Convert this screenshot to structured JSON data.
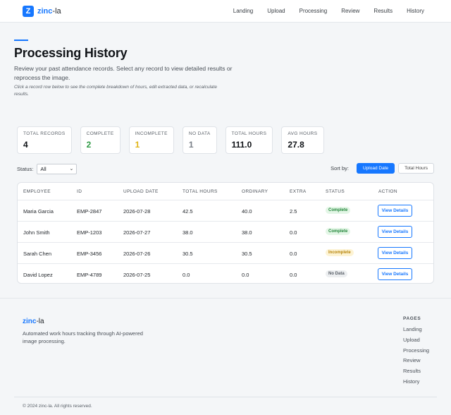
{
  "nav": {
    "logo_glyph": "Z",
    "brand_accent": "zinc",
    "brand_rest": "-la",
    "links": [
      "Landing",
      "Upload",
      "Processing",
      "Review",
      "Results",
      "History"
    ]
  },
  "header": {
    "title": "Processing History",
    "subtitle": "Review your past attendance records. Select any record to view detailed results or reprocess the image.",
    "hint": "Click a record row below to see the complete breakdown of hours, edit extracted data, or recalculate results."
  },
  "stats": [
    {
      "label": "Total Records",
      "value": "4",
      "color": "#111418"
    },
    {
      "label": "Complete",
      "value": "2",
      "color": "#2e9a45"
    },
    {
      "label": "Incomplete",
      "value": "1",
      "color": "#e0b416"
    },
    {
      "label": "No Data",
      "value": "1",
      "color": "#7a8088"
    },
    {
      "label": "Total Hours",
      "value": "111.0",
      "color": "#111418"
    },
    {
      "label": "Avg Hours",
      "value": "27.8",
      "color": "#111418"
    }
  ],
  "filter": {
    "label": "Status:",
    "selected": "All"
  },
  "sort": {
    "label": "Sort by:",
    "options": [
      "Upload Date",
      "Total Hours"
    ],
    "active": "Upload Date"
  },
  "table": {
    "columns": [
      "Employee",
      "ID",
      "Upload Date",
      "Total Hours",
      "Ordinary",
      "Extra",
      "Status",
      "Action"
    ],
    "rows": [
      {
        "employee": "Maria Garcia",
        "id": "EMP-2847",
        "date": "2026-07-28",
        "total": "42.5",
        "ordinary": "40.0",
        "extra": "2.5",
        "status": "Complete",
        "status_kind": "complete",
        "action": "View Details"
      },
      {
        "employee": "John Smith",
        "id": "EMP-1203",
        "date": "2026-07-27",
        "total": "38.0",
        "ordinary": "38.0",
        "extra": "0.0",
        "status": "Complete",
        "status_kind": "complete",
        "action": "View Details"
      },
      {
        "employee": "Sarah Chen",
        "id": "EMP-3456",
        "date": "2026-07-26",
        "total": "30.5",
        "ordinary": "30.5",
        "extra": "0.0",
        "status": "Incomplete",
        "status_kind": "incomplete",
        "action": "View Details"
      },
      {
        "employee": "David Lopez",
        "id": "EMP-4789",
        "date": "2026-07-25",
        "total": "0.0",
        "ordinary": "0.0",
        "extra": "0.0",
        "status": "No Data",
        "status_kind": "nodata",
        "action": "View Details"
      }
    ]
  },
  "footer": {
    "brand_accent": "zinc",
    "brand_rest": "-la",
    "description": "Automated work hours tracking through AI-powered image processing.",
    "pages_heading": "Pages",
    "links": [
      "Landing",
      "Upload",
      "Processing",
      "Review",
      "Results",
      "History"
    ],
    "copyright": "© 2024 zinc-la. All rights reserved."
  },
  "colors": {
    "accent": "#1677ff",
    "complete": "#23863a",
    "incomplete": "#b7850c",
    "nodata": "#5a6068"
  }
}
